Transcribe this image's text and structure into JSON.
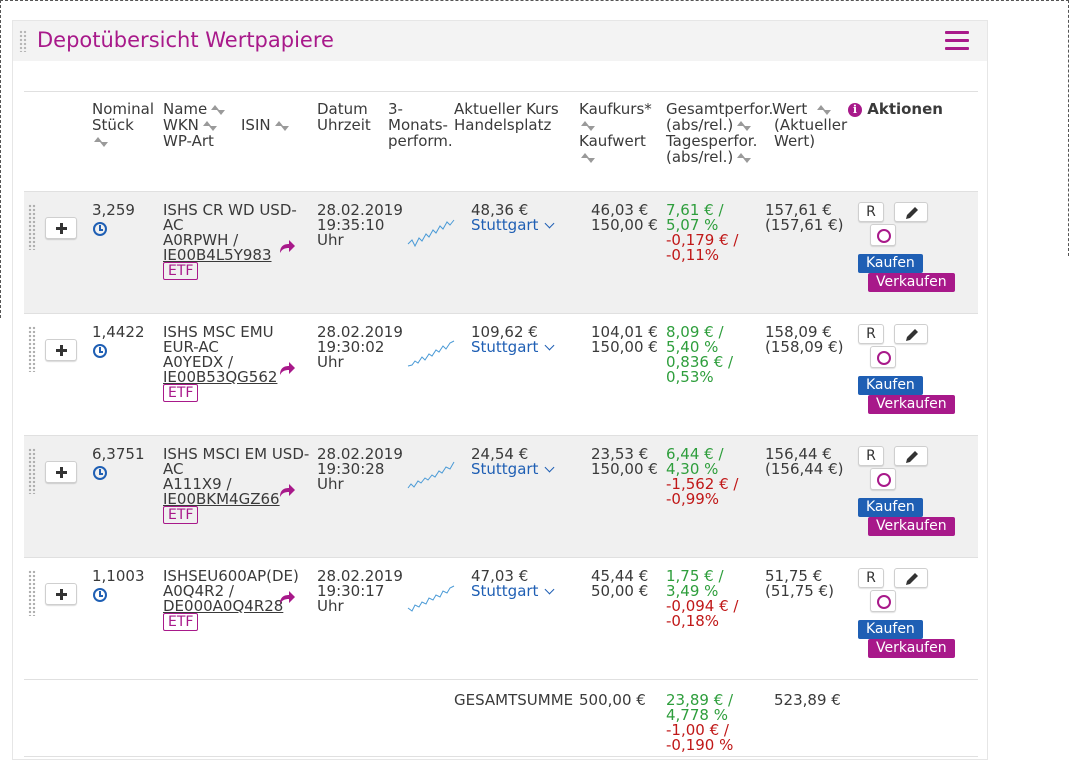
{
  "panel": {
    "title": "Depotübersicht Wertpapiere",
    "accent_color": "#a8198a",
    "link_color": "#1f5fb4",
    "positive_color": "#2e9e3c",
    "negative_color": "#c01818"
  },
  "header": {
    "nominal_l1": "Nominal",
    "nominal_l2": "Stück",
    "name_l1": "Name",
    "name_l2": "WKN",
    "name_l3": "WP-Art",
    "isin": "ISIN",
    "datum_l1": "Datum",
    "datum_l2": "Uhrzeit",
    "perf_l1": "3-",
    "perf_l2": "Monats-",
    "perf_l3": "perform.",
    "kurs_l1": "Aktueller Kurs",
    "kurs_l2": "Handelsplatz",
    "kaufkurs": "Kaufkurs*",
    "kaufwert": "Kaufwert",
    "gesamt_l1": "Gesamtperfor.",
    "gesamt_l2": "(abs/rel.)",
    "tages_l1": "Tagesperfor.",
    "tages_l2": "(abs/rel.)",
    "wert_l1": "Wert",
    "wert_l2": "(Aktueller",
    "wert_l3": "Wert)",
    "aktionen": "Aktionen",
    "info_glyph": "i"
  },
  "rows": [
    {
      "stueck": "3,259",
      "name_l1": "ISHS CR WD USD-",
      "name_l2": "AC",
      "wkn": "A0RPWH /",
      "isin": "IE00B4L5Y983",
      "type": "ETF",
      "datum": "28.02.2019",
      "uhrzeit": "19:35:10",
      "uhr": "Uhr",
      "kurs": "48,36 €",
      "platz": "Stuttgart",
      "kaufkurs": "46,03 €",
      "kaufwert": "150,00 €",
      "gesamt_abs": "7,61 € /",
      "gesamt_rel": "5,07 %",
      "tages_abs": "-0,179 € /",
      "tages_rel": "-0,11%",
      "wert": "157,61 €",
      "wert_akt": "(157,61 €)",
      "r": "R",
      "kaufen": "Kaufen",
      "verkaufen": "Verkaufen"
    },
    {
      "stueck": "1,4422",
      "name_l1": "ISHS MSC EMU",
      "name_l2": "EUR-AC",
      "wkn": "A0YEDX /",
      "isin": "IE00B53QG562",
      "type": "ETF",
      "datum": "28.02.2019",
      "uhrzeit": "19:30:02",
      "uhr": "Uhr",
      "kurs": "109,62 €",
      "platz": "Stuttgart",
      "kaufkurs": "104,01 €",
      "kaufwert": "150,00 €",
      "gesamt_abs": "8,09 € /",
      "gesamt_rel": "5,40 %",
      "tages_abs": "0,836 € /",
      "tages_rel": "0,53%",
      "wert": "158,09 €",
      "wert_akt": "(158,09 €)",
      "r": "R",
      "kaufen": "Kaufen",
      "verkaufen": "Verkaufen"
    },
    {
      "stueck": "6,3751",
      "name_l1": "ISHS MSCI EM USD-",
      "name_l2": "AC",
      "wkn": "A111X9 /",
      "isin": "IE00BKM4GZ66",
      "type": "ETF",
      "datum": "28.02.2019",
      "uhrzeit": "19:30:28",
      "uhr": "Uhr",
      "kurs": "24,54 €",
      "platz": "Stuttgart",
      "kaufkurs": "23,53 €",
      "kaufwert": "150,00 €",
      "gesamt_abs": "6,44 € /",
      "gesamt_rel": "4,30 %",
      "tages_abs": "-1,562 € /",
      "tages_rel": "-0,99%",
      "wert": "156,44 €",
      "wert_akt": "(156,44 €)",
      "r": "R",
      "kaufen": "Kaufen",
      "verkaufen": "Verkaufen"
    },
    {
      "stueck": "1,1003",
      "name_l1": "ISHSEU600AP(DE)",
      "name_l2": "",
      "wkn": "A0Q4R2 /",
      "isin": "DE000A0Q4R28",
      "type": "ETF",
      "datum": "28.02.2019",
      "uhrzeit": "19:30:17",
      "uhr": "Uhr",
      "kurs": "47,03 €",
      "platz": "Stuttgart",
      "kaufkurs": "45,44 €",
      "kaufwert": "50,00 €",
      "gesamt_abs": "1,75 € /",
      "gesamt_rel": "3,49 %",
      "tages_abs": "-0,094 € /",
      "tages_rel": "-0,18%",
      "wert": "51,75 €",
      "wert_akt": "(51,75 €)",
      "r": "R",
      "kaufen": "Kaufen",
      "verkaufen": "Verkaufen"
    }
  ],
  "total": {
    "label": "GESAMTSUMME",
    "kaufwert": "500,00 €",
    "gesamt_abs": "23,89 € /",
    "gesamt_rel": "4,778 %",
    "tages_abs": "-1,00 € /",
    "tages_rel": "-0,190 %",
    "wert": "523,89 €"
  }
}
